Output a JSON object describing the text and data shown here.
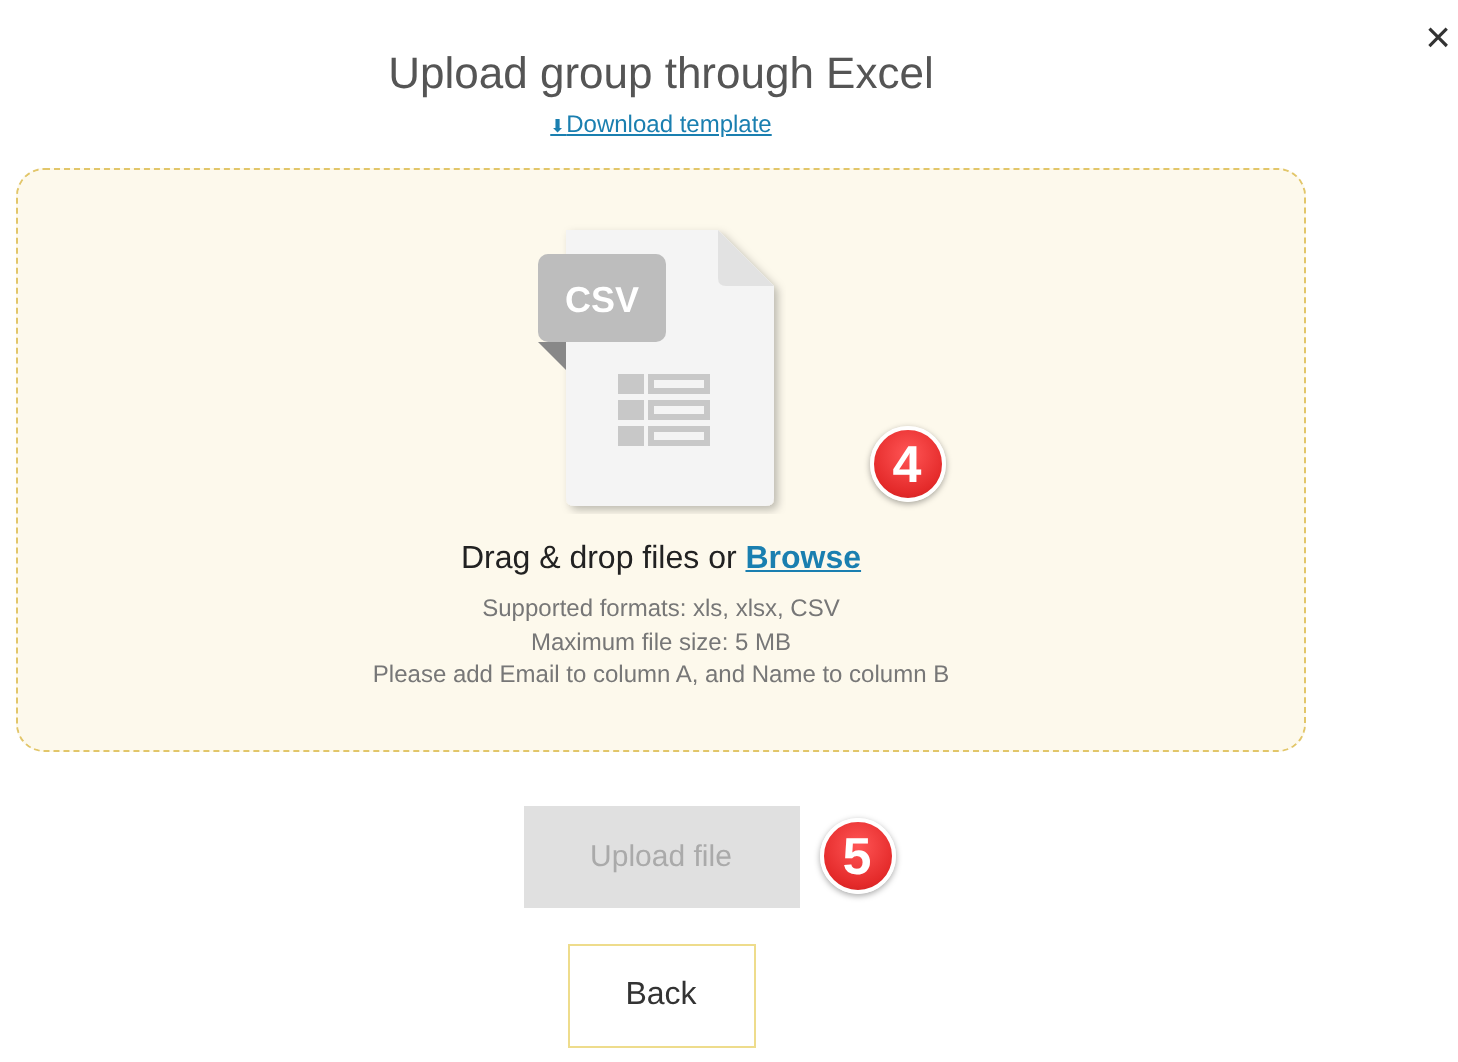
{
  "close": "×",
  "title": "Upload group through Excel",
  "download_link": {
    "icon": "⬇",
    "label": "Download template"
  },
  "dropzone": {
    "file_label": "CSV",
    "prompt": "Drag & drop files or ",
    "browse": "Browse",
    "notes": [
      "Supported formats: xls, xlsx, CSV",
      "Maximum file size: 5 MB",
      "Please add Email to column A, and Name to column B"
    ],
    "marker": "4"
  },
  "upload_button": {
    "label": "Upload file",
    "disabled": true,
    "marker": "5"
  },
  "back_button": {
    "label": "Back"
  }
}
